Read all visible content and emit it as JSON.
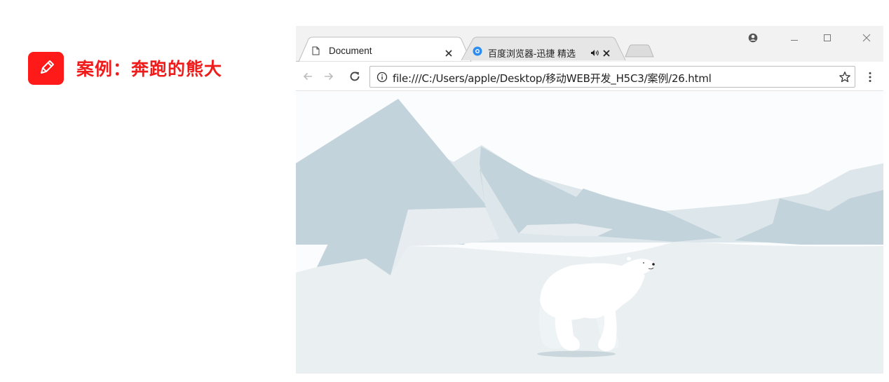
{
  "slide": {
    "title": "案例：奔跑的熊大",
    "accent": "#ef1c1c"
  },
  "browser": {
    "tabs": [
      {
        "title": "Document",
        "active": true
      },
      {
        "title": "百度浏览器-迅捷 精选",
        "active": false,
        "audio": true
      }
    ],
    "address": "file:///C:/Users/apple/Desktop/移动WEB开发_H5C3/案例/26.html",
    "icons": [
      "page-icon",
      "close-icon",
      "audio-icon",
      "back-icon",
      "forward-icon",
      "reload-icon",
      "info-icon",
      "star-icon",
      "menu-icon",
      "profile-icon",
      "minimize-icon",
      "maximize-icon",
      "window-close-icon"
    ]
  },
  "scene": {
    "subject": "polar bear running across snowy mountains",
    "colors": {
      "sky": "#fafcfd",
      "far_mountain": "#dde6ea",
      "near_mountain": "#c3d3db",
      "snow_ground": "#eaeff2",
      "bear": "#ffffff"
    }
  }
}
